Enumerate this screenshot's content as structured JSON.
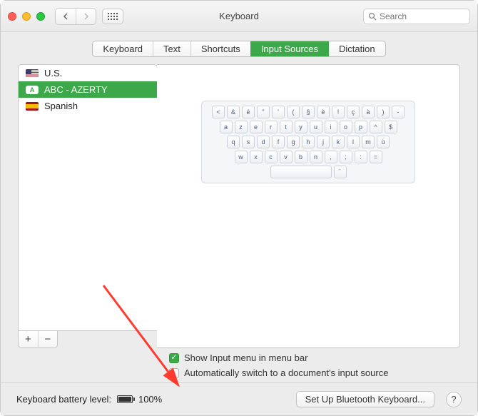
{
  "window": {
    "title": "Keyboard"
  },
  "search": {
    "placeholder": "Search"
  },
  "tabs": {
    "keyboard": "Keyboard",
    "text": "Text",
    "shortcuts": "Shortcuts",
    "input_sources": "Input Sources",
    "dictation": "Dictation",
    "active": "input_sources"
  },
  "sources": {
    "items": [
      {
        "label": "U.S.",
        "flag": "us",
        "selected": false
      },
      {
        "label": "ABC - AZERTY",
        "flag": "a",
        "selected": true
      },
      {
        "label": "Spanish",
        "flag": "es",
        "selected": false
      }
    ]
  },
  "add_label": "+",
  "remove_label": "−",
  "keyboard_layout": {
    "rows": [
      [
        "<",
        "&",
        "é",
        "\"",
        "'",
        "(",
        "§",
        "è",
        "!",
        "ç",
        "à",
        ")",
        "-"
      ],
      [
        "a",
        "z",
        "e",
        "r",
        "t",
        "y",
        "u",
        "i",
        "o",
        "p",
        "^",
        "$"
      ],
      [
        "q",
        "s",
        "d",
        "f",
        "g",
        "h",
        "j",
        "k",
        "l",
        "m",
        "ù"
      ],
      [
        "w",
        "x",
        "c",
        "v",
        "b",
        "n",
        ",",
        ";",
        ":",
        "="
      ],
      [
        "",
        "`"
      ]
    ]
  },
  "options": {
    "show_input_menu": {
      "label": "Show Input menu in menu bar",
      "checked": true
    },
    "auto_switch": {
      "label": "Automatically switch to a document's input source",
      "checked": false
    }
  },
  "bottom": {
    "battery_label": "Keyboard battery level:",
    "battery_value": "100%",
    "bluetooth_button": "Set Up Bluetooth Keyboard...",
    "help": "?"
  }
}
